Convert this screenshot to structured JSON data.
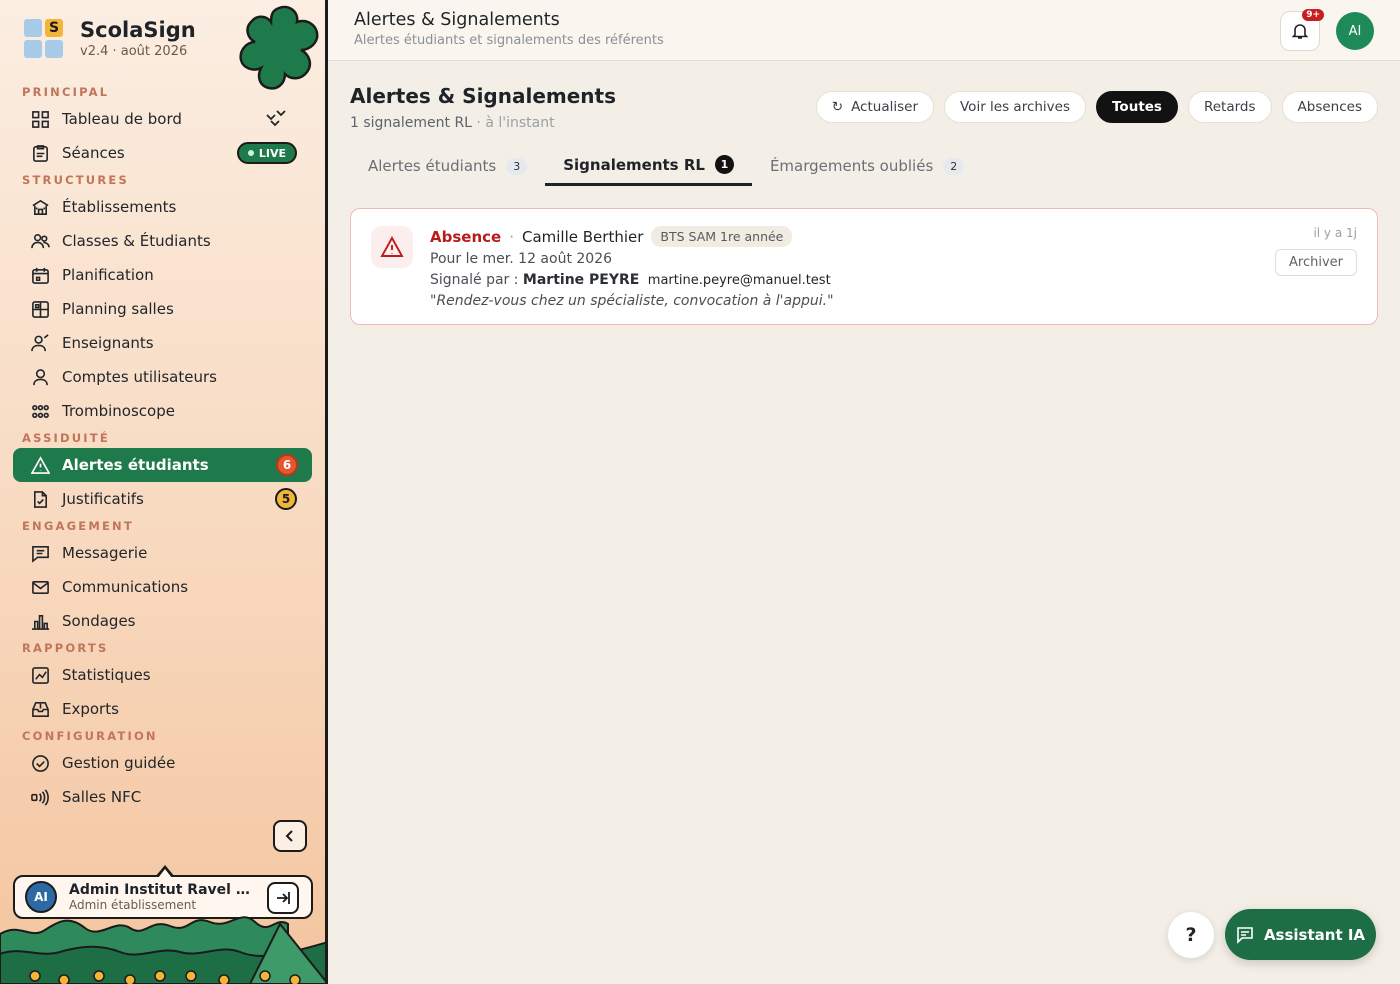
{
  "brand": {
    "name": "ScolaSign",
    "version": "v2.4 · août 2026",
    "logo_letter": "S"
  },
  "sidebar": {
    "live_label": "LIVE",
    "sections": {
      "principal": "PRINCIPAL",
      "structures": "STRUCTURES",
      "assiduite": "ASSIDUITÉ",
      "engagement": "ENGAGEMENT",
      "rapports": "RAPPORTS",
      "configuration": "CONFIGURATION"
    },
    "items": {
      "tableau": "Tableau de bord",
      "seances": "Séances",
      "etablissements": "Établissements",
      "classes": "Classes & Étudiants",
      "planification": "Planification",
      "planning_salles": "Planning salles",
      "enseignants": "Enseignants",
      "comptes": "Comptes utilisateurs",
      "trombinoscope": "Trombinoscope",
      "alertes": "Alertes étudiants",
      "justificatifs": "Justificatifs",
      "messagerie": "Messagerie",
      "communications": "Communications",
      "sondages": "Sondages",
      "statistiques": "Statistiques",
      "exports": "Exports",
      "gestion": "Gestion guidée",
      "salles_nfc": "Salles NFC"
    },
    "counts": {
      "alertes": "6",
      "justificatifs": "5"
    }
  },
  "user": {
    "initials": "AI",
    "name": "Admin Institut Ravel For...",
    "role": "Admin établissement"
  },
  "topbar": {
    "title": "Alertes & Signalements",
    "subtitle": "Alertes étudiants et signalements des référents",
    "notif_badge": "9+",
    "avatar": "AI"
  },
  "page": {
    "title": "Alertes & Signalements",
    "count_text": "1 signalement RL",
    "updated_text": "· à l'instant"
  },
  "filters": {
    "refresh": "Actualiser",
    "archives": "Voir les archives",
    "all": "Toutes",
    "delays": "Retards",
    "absences": "Absences"
  },
  "tabs": [
    {
      "label": "Alertes étudiants",
      "count": "3"
    },
    {
      "label": "Signalements RL",
      "count": "1"
    },
    {
      "label": "Émargements oubliés",
      "count": "2"
    }
  ],
  "signalement": {
    "type": "Absence",
    "separator": "·",
    "student": "Camille Berthier",
    "class": "BTS SAM 1re année",
    "date": "Pour le mer. 12 août 2026",
    "reported_by_label": "Signalé par :",
    "reporter": "Martine PEYRE",
    "email": "martine.peyre@manuel.test",
    "comment": "\"Rendez-vous chez un spécialiste, convocation à l'appui.\"",
    "time_ago": "il y a 1j",
    "archive_label": "Archiver"
  },
  "floating": {
    "help": "?",
    "assistant": "Assistant IA"
  },
  "colors": {
    "accent": "#1e7a4a",
    "danger": "#b91c1c",
    "badge_orange": "#f2b53a"
  }
}
